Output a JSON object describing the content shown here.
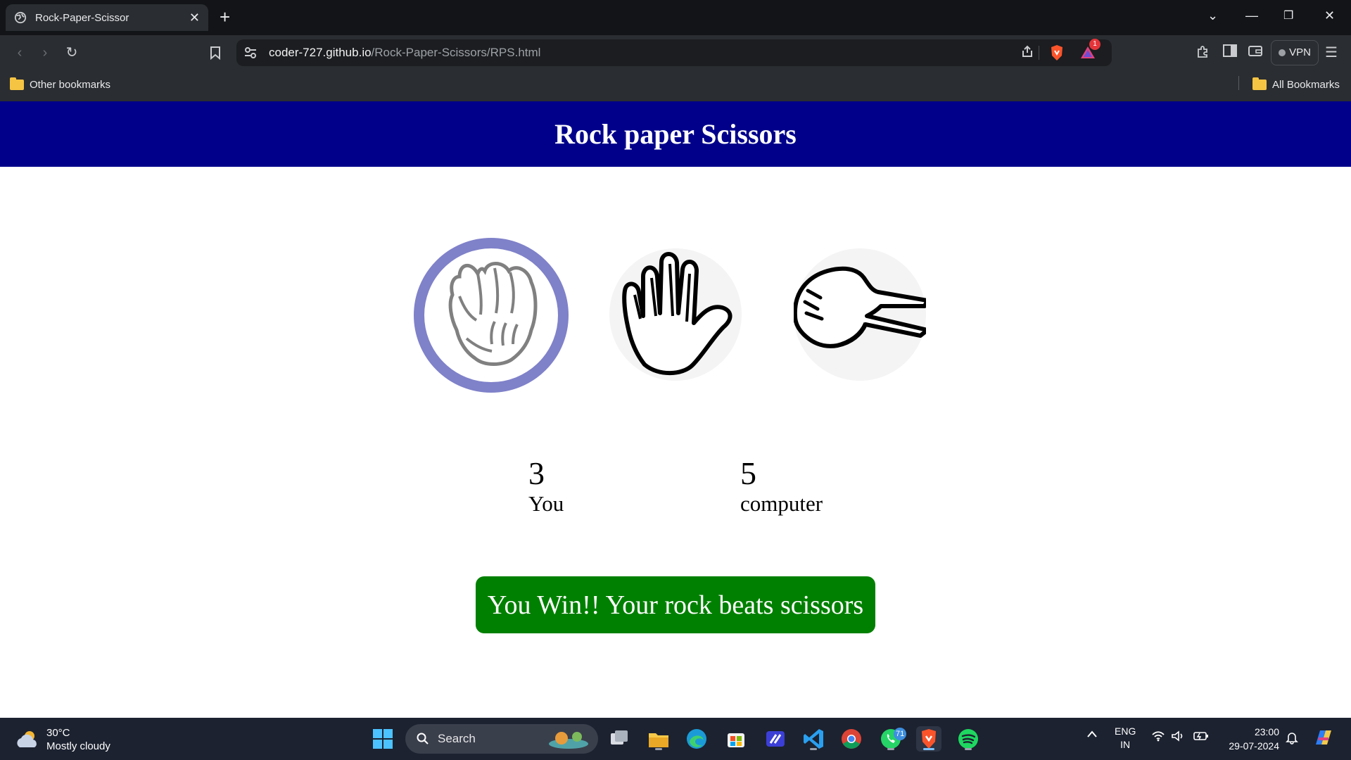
{
  "browser": {
    "tab_title": "Rock-Paper-Scissor",
    "url_host": "coder-727.github.io",
    "url_path": "/Rock-Paper-Scissors/RPS.html",
    "vpn_label": "VPN",
    "notification_count": "1",
    "bookmarks": {
      "left": "Other bookmarks",
      "right": "All Bookmarks"
    }
  },
  "page": {
    "title": "Rock paper Scissors",
    "choices": [
      {
        "id": "rock",
        "selected": true
      },
      {
        "id": "paper",
        "selected": false
      },
      {
        "id": "scissors",
        "selected": false
      }
    ],
    "scores": {
      "user": {
        "value": "3",
        "label": "You"
      },
      "computer": {
        "value": "5",
        "label": "computer"
      }
    },
    "message": "You Win!! Your rock beats scissors",
    "colors": {
      "banner": "#00008b",
      "selected_ring": "#7f81c9",
      "message_bg": "#008000"
    }
  },
  "taskbar": {
    "weather_temp": "30°C",
    "weather_desc": "Mostly cloudy",
    "search_label": "Search",
    "whatsapp_badge": "71",
    "lang_line1": "ENG",
    "lang_line2": "IN",
    "time": "23:00",
    "date": "29-07-2024"
  }
}
